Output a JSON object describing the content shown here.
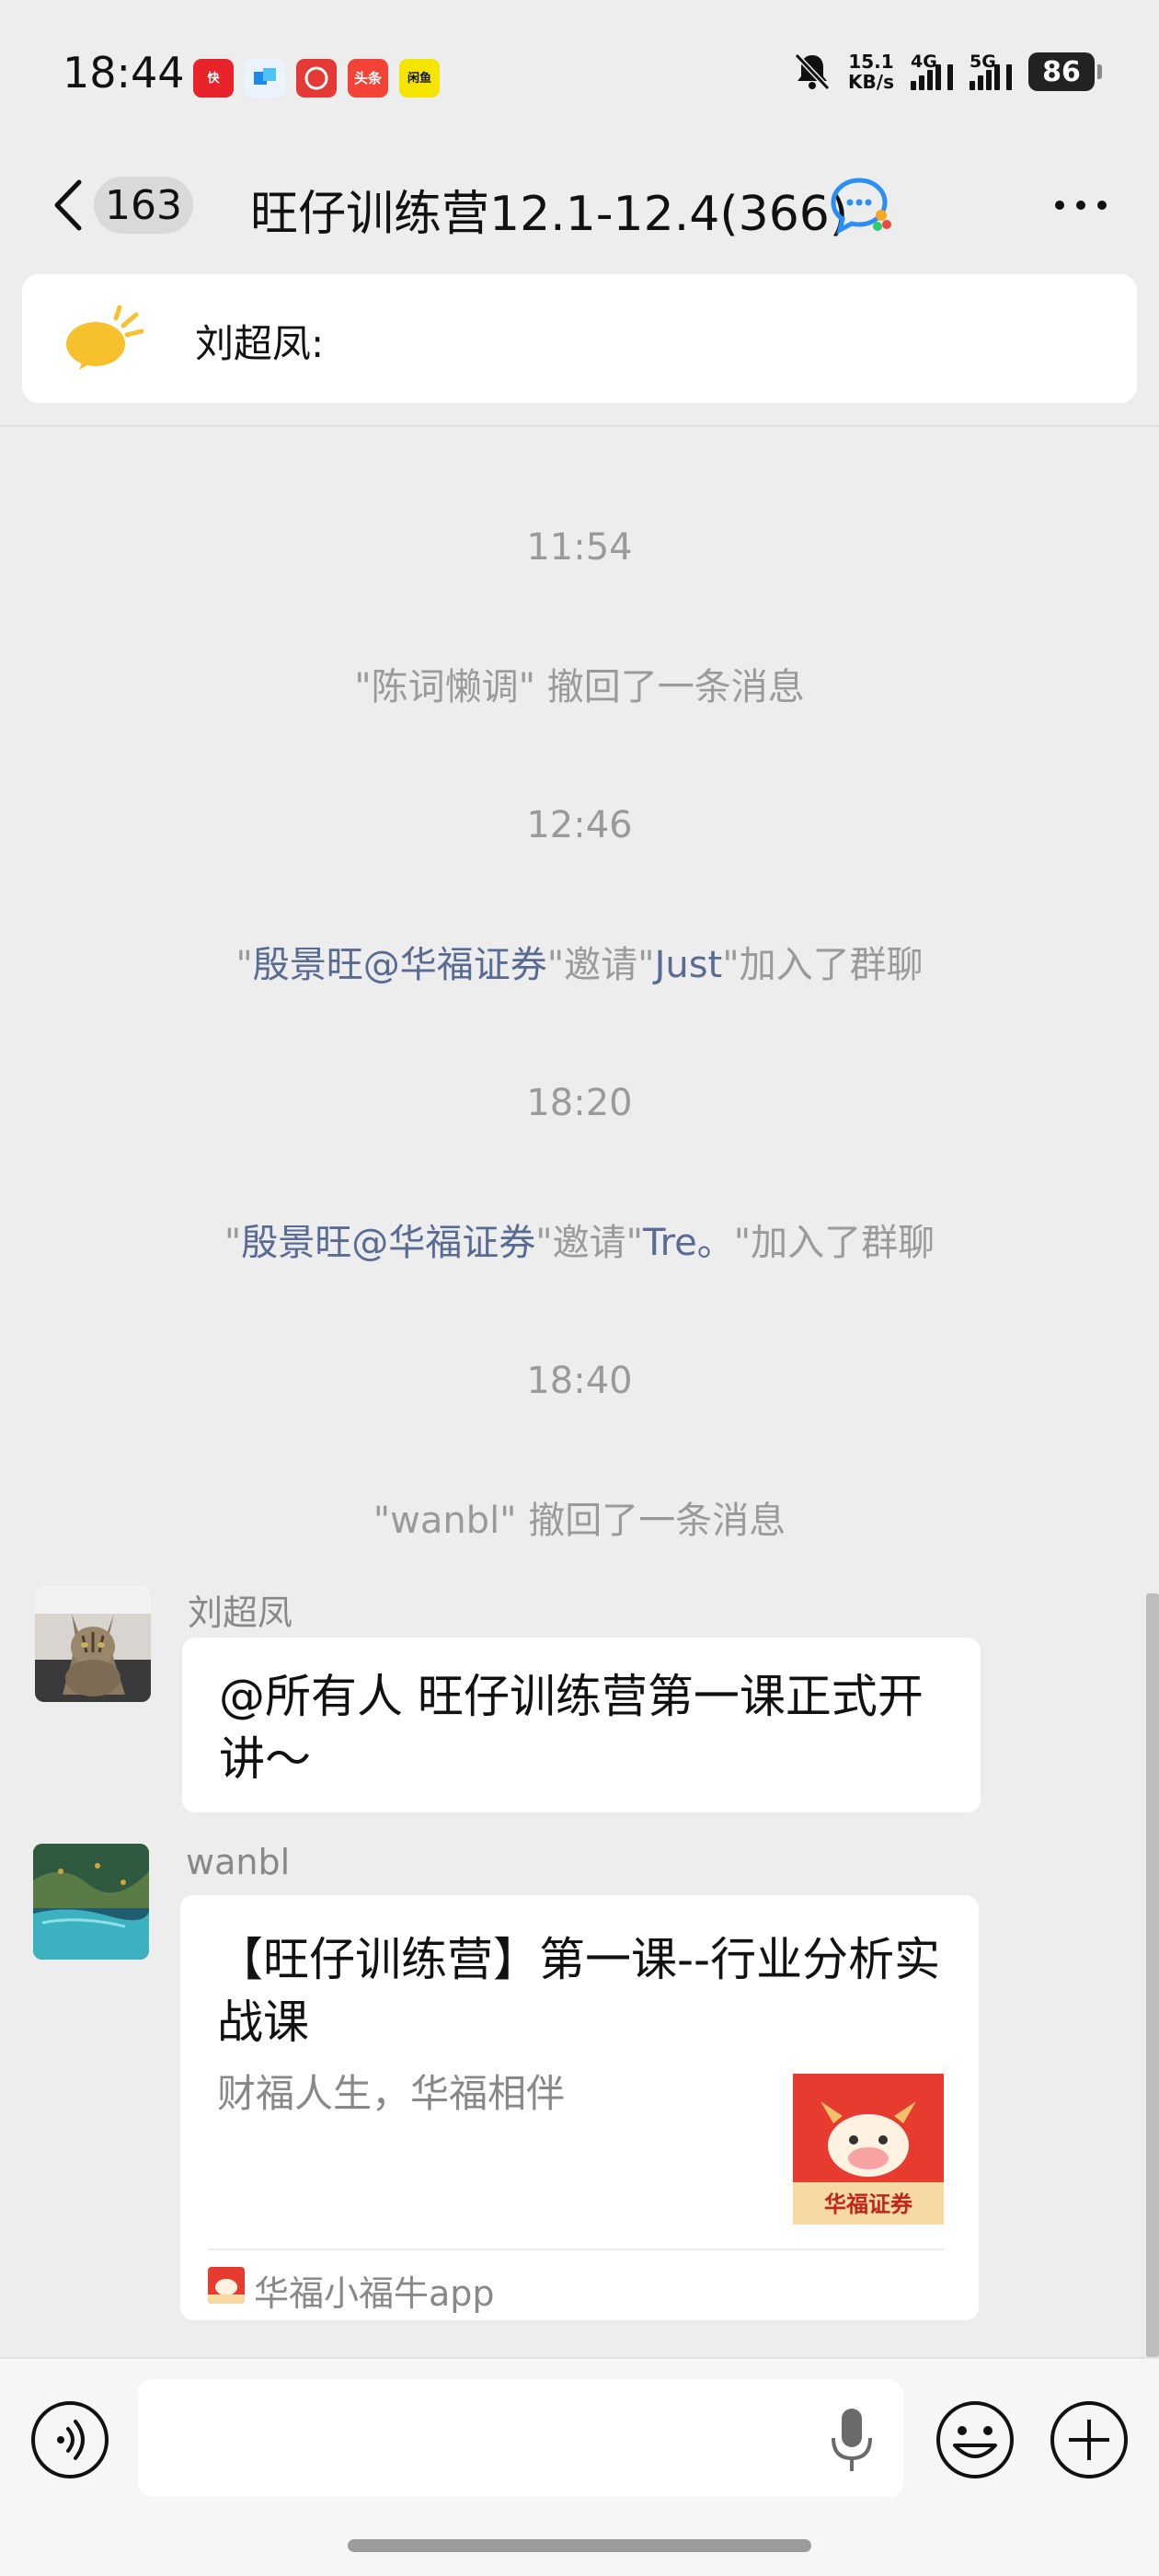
{
  "status_bar": {
    "time": "18:44",
    "notification_icons": [
      {
        "name": "app-notification-icon-1",
        "color": "#e8232a",
        "label": "快"
      },
      {
        "name": "app-notification-icon-2",
        "color": "#1e88e5",
        "label": ""
      },
      {
        "name": "app-notification-icon-3",
        "color": "#e53935",
        "label": ""
      },
      {
        "name": "app-notification-icon-4",
        "color": "#f44336",
        "label": "头条"
      },
      {
        "name": "app-notification-icon-5",
        "color": "#f5e400",
        "label": "闲鱼"
      }
    ],
    "network_speed_value": "15.1",
    "network_speed_unit": "KB/s",
    "signal_1_label": "4G",
    "signal_2_label": "5G",
    "battery": "86"
  },
  "title_bar": {
    "unread_count": "163",
    "chat_title": "旺仔训练营12.1-12.4(366)",
    "icons": [
      "back-icon",
      "assistant-icon",
      "more-icon"
    ]
  },
  "pinned": {
    "label": "刘超凤:",
    "icon": "megaphone-icon",
    "icon_color": "#f7c12d"
  },
  "messages": {
    "time_1": "11:54",
    "recall_1": "\"陈词懒调\" 撤回了一条消息",
    "time_2": "12:46",
    "invite_1": {
      "q1": "\"",
      "inviter": "殷景旺@华福证券",
      "mid": "\"邀请\"",
      "invitee": "Just",
      "tail": "\"加入了群聊"
    },
    "time_3": "18:20",
    "invite_2": {
      "q1": "\"",
      "inviter": "殷景旺@华福证券",
      "mid": "\"邀请\"",
      "invitee": "Tre。",
      "tail": "\"加入了群聊"
    },
    "time_4": "18:40",
    "recall_2": "\"wanbl\" 撤回了一条消息",
    "msg_1": {
      "sender": "刘超凤",
      "text": "@所有人 旺仔训练营第一课正式开讲～"
    },
    "msg_2": {
      "sender": "wanbl",
      "card_title": "【旺仔训练营】第一课--行业分析实战课",
      "card_desc": "财福人生，华福相伴",
      "thumb_text": "华福证券",
      "source": "华福小福牛app"
    }
  },
  "colors": {
    "background": "#ededed",
    "link": "#576b95",
    "system_text": "#9a9a9a"
  }
}
